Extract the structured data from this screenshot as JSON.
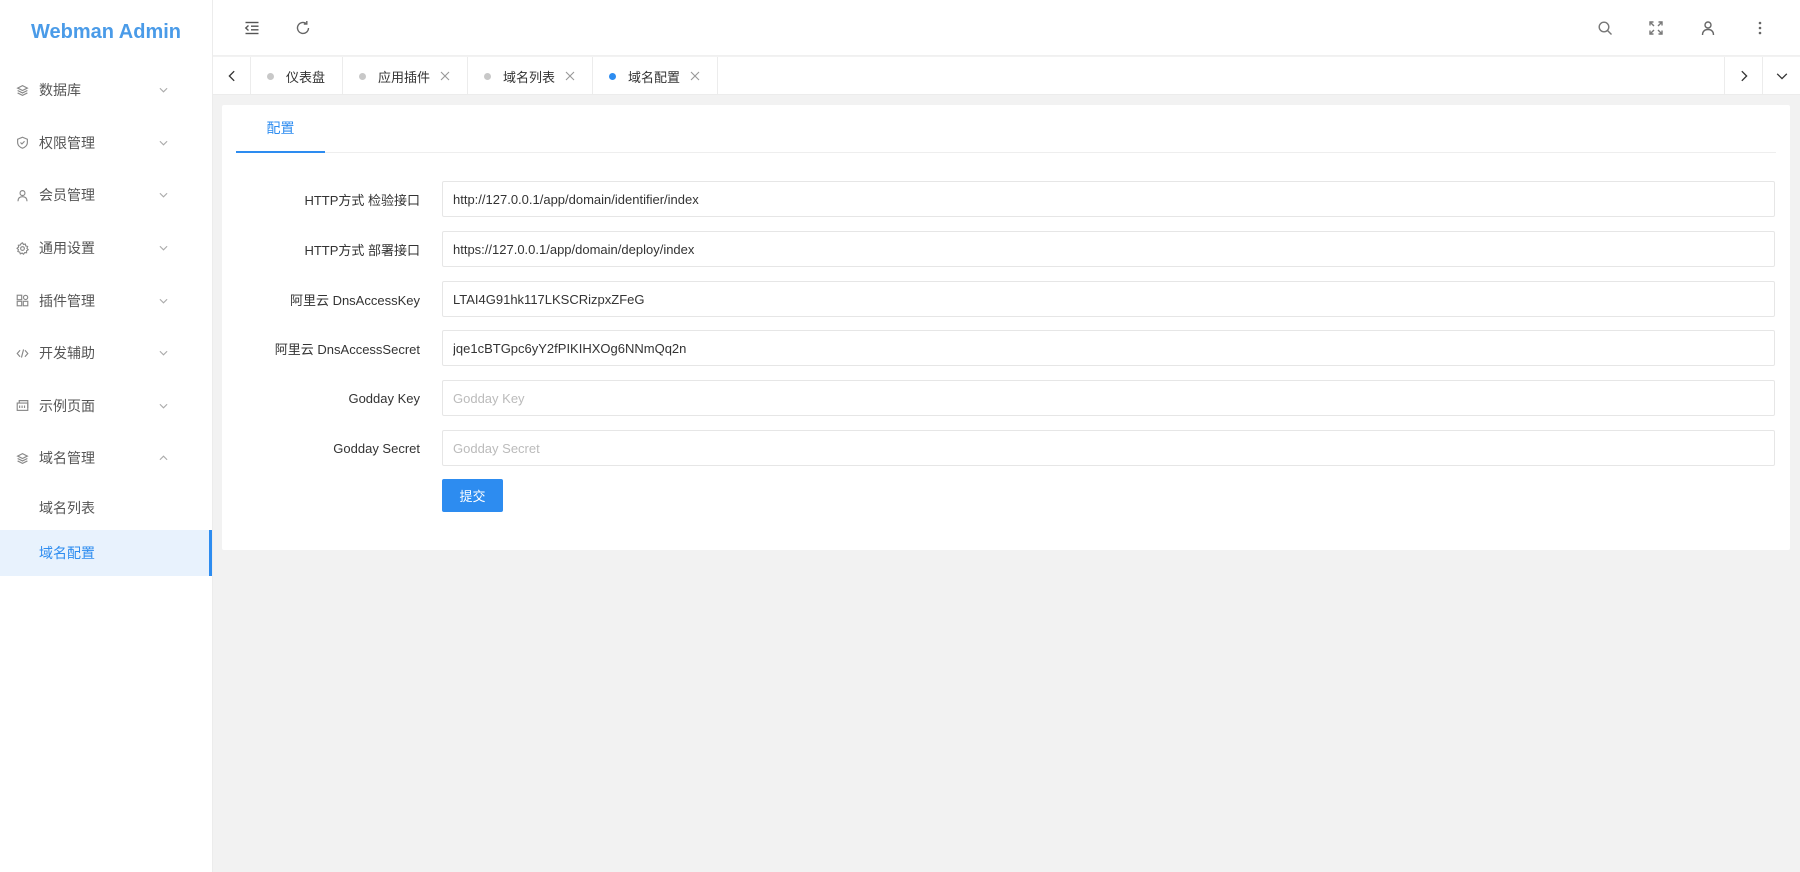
{
  "app": {
    "title": "Webman Admin",
    "accent": "#2d8cf0"
  },
  "sidebar": {
    "items": [
      {
        "label": "数据库",
        "icon": "layers-icon"
      },
      {
        "label": "权限管理",
        "icon": "shield-icon"
      },
      {
        "label": "会员管理",
        "icon": "user-icon"
      },
      {
        "label": "通用设置",
        "icon": "gear-icon"
      },
      {
        "label": "插件管理",
        "icon": "plugin-icon"
      },
      {
        "label": "开发辅助",
        "icon": "code-icon"
      },
      {
        "label": "示例页面",
        "icon": "template-icon"
      },
      {
        "label": "域名管理",
        "icon": "layers-icon",
        "expanded": true
      }
    ],
    "subitems": [
      {
        "label": "域名列表"
      },
      {
        "label": "域名配置",
        "active": true
      }
    ]
  },
  "header": {
    "buttons": [
      "menu-fold-icon",
      "refresh-icon",
      "search-icon",
      "fullscreen-icon",
      "user-icon",
      "more-icon"
    ]
  },
  "tabs": [
    {
      "label": "仪表盘",
      "closable": false
    },
    {
      "label": "应用插件",
      "closable": true
    },
    {
      "label": "域名列表",
      "closable": true
    },
    {
      "label": "域名配置",
      "closable": true,
      "active": true
    }
  ],
  "card": {
    "tab_label": "配置",
    "fields": [
      {
        "label": "HTTP方式 检验接口",
        "value": "http://127.0.0.1/app/domain/identifier/index",
        "placeholder": ""
      },
      {
        "label": "HTTP方式 部署接口",
        "value": "https://127.0.0.1/app/domain/deploy/index",
        "placeholder": ""
      },
      {
        "label": "阿里云 DnsAccessKey",
        "value": "LTAI4G91hk117LKSCRizpxZFeG",
        "placeholder": ""
      },
      {
        "label": "阿里云 DnsAccessSecret",
        "value": "jqe1cBTGpc6yY2fPIKIHXOg6NNmQq2n",
        "placeholder": ""
      },
      {
        "label": "Godday Key",
        "value": "",
        "placeholder": "Godday Key"
      },
      {
        "label": "Godday Secret",
        "value": "",
        "placeholder": "Godday Secret"
      }
    ],
    "submit_label": "提交"
  }
}
